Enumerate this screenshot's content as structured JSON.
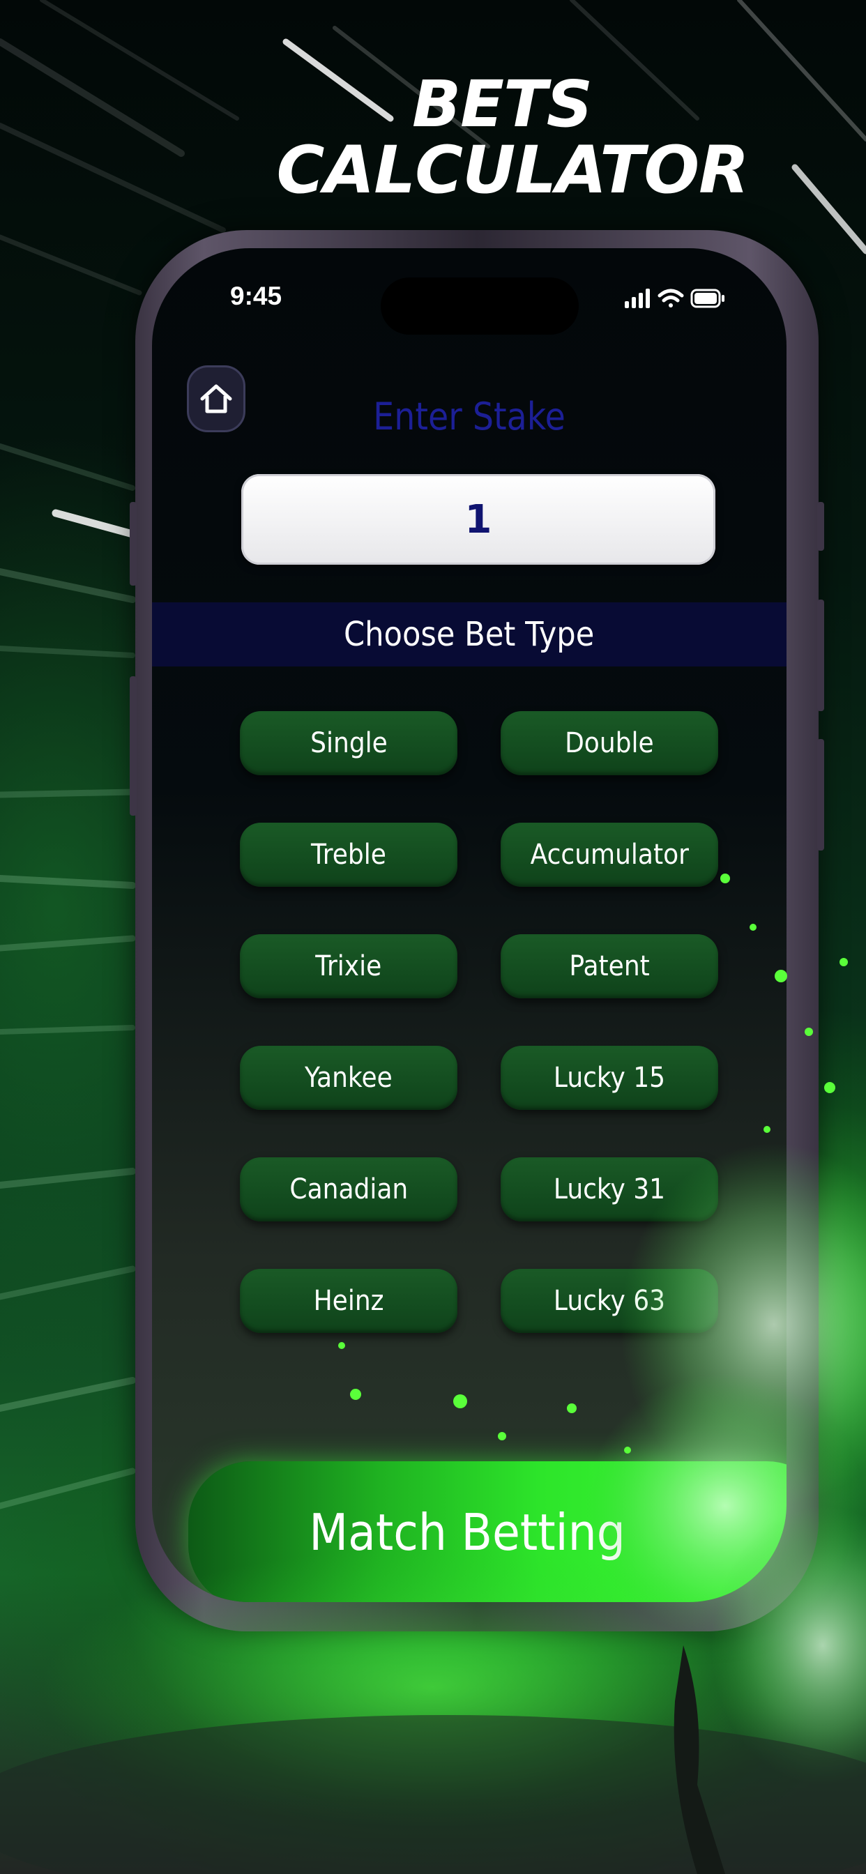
{
  "promo": {
    "headline_line1": "BETS",
    "headline_line2": "CALCULATOR"
  },
  "status_bar": {
    "time": "9:45",
    "icons": [
      "signal-icon",
      "wifi-icon",
      "battery-icon"
    ]
  },
  "header": {
    "home_icon": "home-icon",
    "title": "Enter Stake"
  },
  "stake": {
    "value": "1"
  },
  "bet_type_section": {
    "title": "Choose Bet Type",
    "options": [
      "Single",
      "Double",
      "Treble",
      "Accumulator",
      "Trixie",
      "Patent",
      "Yankee",
      "Lucky 15",
      "Canadian",
      "Lucky 31",
      "Heinz",
      "Lucky 63"
    ]
  },
  "footer": {
    "match_button_label": "Match Betting"
  },
  "colors": {
    "accent_green": "#2de52a",
    "button_green": "#1a5a26",
    "title_blue": "#1c1f96",
    "banner_navy": "#080b34"
  }
}
